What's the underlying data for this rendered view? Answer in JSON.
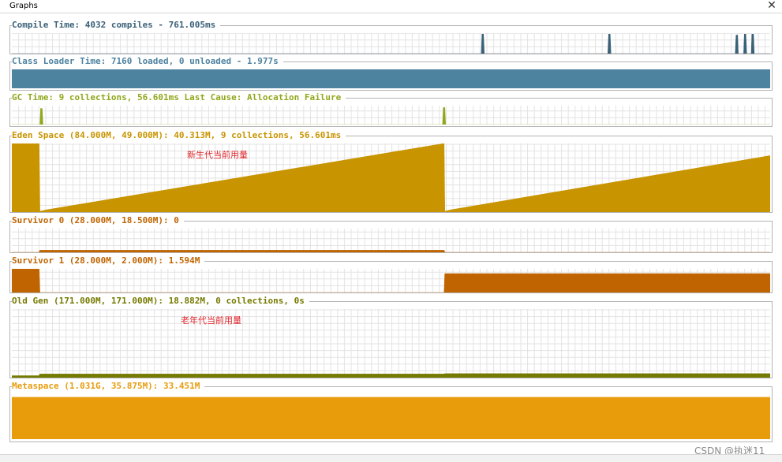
{
  "window": {
    "title": "Graphs",
    "close_glyph": "✕"
  },
  "panels": [
    {
      "title": "Compile Time: 4032 compiles - 761.005ms",
      "color": "#3a6178",
      "chart": "compile_time"
    },
    {
      "title": "Class Loader Time: 7160 loaded, 0 unloaded - 1.977s",
      "color": "#4e83a0",
      "chart": "class_loader_time"
    },
    {
      "title": "GC Time: 9 collections, 56.601ms Last Cause: Allocation Failure",
      "color": "#8fa81b",
      "chart": "gc_time"
    },
    {
      "title": "Eden Space (84.000M, 49.000M): 40.313M, 9 collections, 56.601ms",
      "color": "#c89400",
      "chart": "eden_space"
    },
    {
      "title": "Survivor 0 (28.000M, 18.500M): 0",
      "color": "#bf6400",
      "chart": "survivor_0"
    },
    {
      "title": "Survivor 1 (28.000M, 2.000M): 1.594M",
      "color": "#bf6400",
      "chart": "survivor_1"
    },
    {
      "title": "Old Gen (171.000M, 171.000M): 18.882M, 0 collections, 0s",
      "color": "#757a00",
      "chart": "old_gen"
    },
    {
      "title": "Metaspace (1.031G, 35.875M): 33.451M",
      "color": "#e89c0c",
      "chart": "metaspace"
    }
  ],
  "annotations": {
    "eden": "新生代当前用量",
    "old_gen": "老年代当前用量"
  },
  "watermark": "CSDN @执迷11",
  "chart_data": [
    {
      "id": "compile_time",
      "type": "area",
      "color": "#3a6178",
      "title": "Compile Time: 4032 compiles - 761.005ms",
      "xlim": [
        0,
        1
      ],
      "ylim": [
        0,
        1
      ],
      "grid": true,
      "x": [
        0,
        0.619,
        0.62,
        0.622,
        0.623,
        0.786,
        0.787,
        0.789,
        0.79,
        0.954,
        0.955,
        0.957,
        0.958,
        0.965,
        0.966,
        0.968,
        0.969,
        0.975,
        0.976,
        0.978,
        0.979,
        1
      ],
      "values": [
        0,
        0,
        0.95,
        0.95,
        0,
        0,
        0.95,
        0.95,
        0,
        0,
        0.9,
        0.9,
        0,
        0,
        0.95,
        0.95,
        0,
        0,
        0.95,
        0.95,
        0,
        0
      ]
    },
    {
      "id": "class_loader_time",
      "type": "area",
      "color": "#4e83a0",
      "title": "Class Loader Time: 7160 loaded, 0 unloaded - 1.977s",
      "xlim": [
        0,
        1
      ],
      "ylim": [
        0,
        1
      ],
      "grid": false,
      "x": [
        0,
        1
      ],
      "values": [
        1,
        1
      ]
    },
    {
      "id": "gc_time",
      "type": "area",
      "color": "#8fa81b",
      "title": "GC Time: 9 collections, 56.601ms Last Cause: Allocation Failure",
      "xlim": [
        0,
        1
      ],
      "ylim": [
        0,
        1
      ],
      "grid": true,
      "x": [
        0,
        0.037,
        0.038,
        0.04,
        0.041,
        0.568,
        0.569,
        0.571,
        0.572,
        1
      ],
      "values": [
        0,
        0,
        0.85,
        0.85,
        0,
        0,
        0.9,
        0.9,
        0,
        0
      ]
    },
    {
      "id": "eden_space",
      "type": "area",
      "color": "#c89400",
      "title": "Eden Space (84.000M, 49.000M): 40.313M, 9 collections, 56.601ms",
      "xlim": [
        0,
        1
      ],
      "ylim": [
        0,
        49
      ],
      "grid": true,
      "x": [
        0,
        0.036,
        0.037,
        0.045,
        0.57,
        0.571,
        0.578,
        1
      ],
      "values": [
        49,
        49,
        0.5,
        1.5,
        49,
        0.5,
        1.5,
        40.313
      ]
    },
    {
      "id": "survivor_0",
      "type": "area",
      "color": "#bf6400",
      "title": "Survivor 0 (28.000M, 18.500M): 0",
      "xlim": [
        0,
        1
      ],
      "ylim": [
        0,
        18.5
      ],
      "grid": true,
      "x": [
        0,
        0.036,
        0.037,
        0.57,
        0.571,
        1
      ],
      "values": [
        0,
        0,
        1.594,
        1.594,
        0,
        0
      ]
    },
    {
      "id": "survivor_1",
      "type": "area",
      "color": "#bf6400",
      "title": "Survivor 1 (28.000M, 2.000M): 1.594M",
      "xlim": [
        0,
        1
      ],
      "ylim": [
        0,
        2
      ],
      "grid": true,
      "x": [
        0,
        0.036,
        0.037,
        0.57,
        0.571,
        1
      ],
      "values": [
        2,
        2,
        0,
        0,
        1.594,
        1.594
      ]
    },
    {
      "id": "old_gen",
      "type": "area",
      "color": "#757a00",
      "title": "Old Gen (171.000M, 171.000M): 18.882M, 0 collections, 0s",
      "xlim": [
        0,
        1
      ],
      "ylim": [
        0,
        171
      ],
      "grid": true,
      "x": [
        0,
        0.036,
        0.037,
        0.57,
        0.571,
        1
      ],
      "values": [
        5,
        5,
        9,
        9,
        10,
        10
      ]
    },
    {
      "id": "metaspace",
      "type": "area",
      "color": "#e89c0c",
      "title": "Metaspace (1.031G, 35.875M): 33.451M",
      "xlim": [
        0,
        1
      ],
      "ylim": [
        0,
        35.875
      ],
      "grid": false,
      "x": [
        0,
        1
      ],
      "values": [
        33.451,
        33.451
      ]
    }
  ]
}
